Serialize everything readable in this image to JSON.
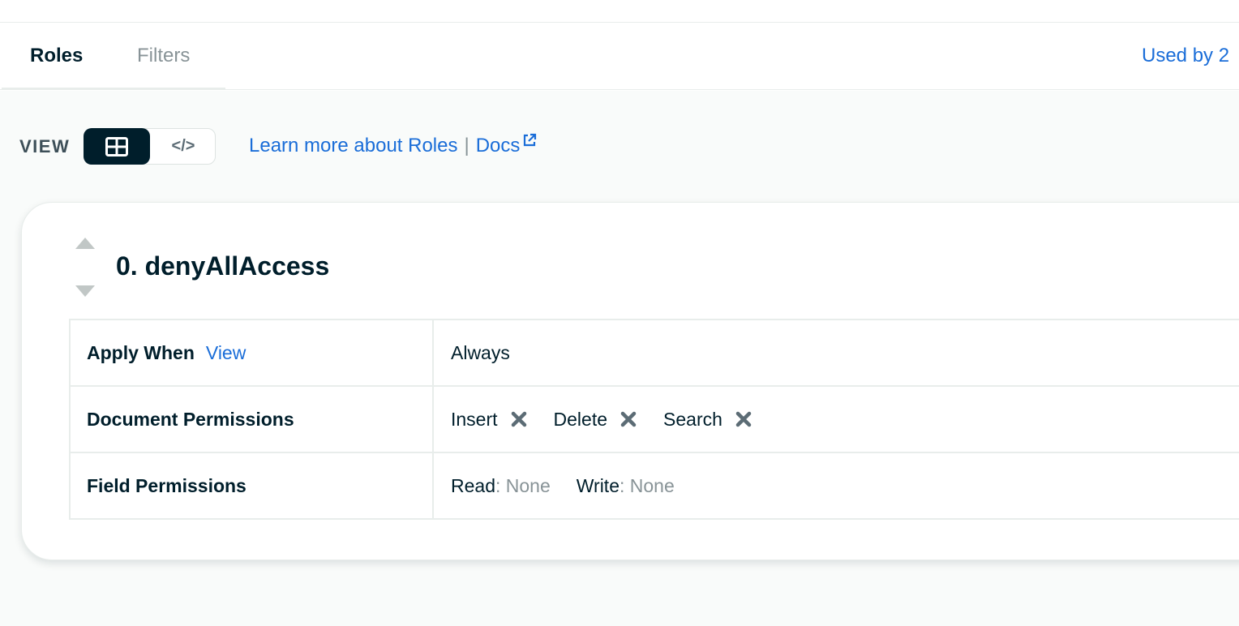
{
  "tabs": [
    {
      "label": "Roles",
      "active": true
    },
    {
      "label": "Filters",
      "active": false
    }
  ],
  "used_by": "Used by 2",
  "view": {
    "label": "VIEW",
    "modes": [
      {
        "name": "table-icon",
        "active": true
      },
      {
        "name": "code-icon",
        "glyph": "</>",
        "active": false
      }
    ]
  },
  "links": {
    "learn_more": "Learn more about Roles",
    "separator": "|",
    "docs": "Docs"
  },
  "role": {
    "title": "0. denyAllAccess",
    "apply_when_label": "Apply When",
    "apply_when_link": "View",
    "apply_when_value": "Always",
    "document_permissions_label": "Document Permissions",
    "document_permissions": [
      "Insert",
      "Delete",
      "Search"
    ],
    "field_permissions_label": "Field Permissions",
    "read_label": "Read",
    "read_value": "None",
    "write_label": "Write",
    "write_value": "None",
    "colon": ":"
  },
  "colors": {
    "accent": "#1a6dd8",
    "dark": "#001e2b",
    "muted": "#889397"
  }
}
